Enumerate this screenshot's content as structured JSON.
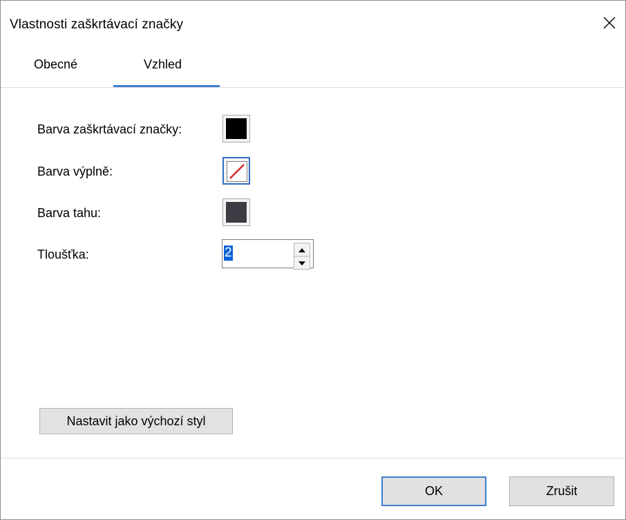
{
  "window": {
    "title": "Vlastnosti zaškrtávací značky"
  },
  "tabs": [
    {
      "label": "Obecné",
      "active": false
    },
    {
      "label": "Vzhled",
      "active": true
    }
  ],
  "appearance": {
    "check_color": {
      "label": "Barva zaškrtávací značky:",
      "color": "#000000"
    },
    "fill_color": {
      "label": "Barva výplně:",
      "value": "none",
      "icon": "no-color-icon"
    },
    "stroke_color": {
      "label": "Barva tahu:",
      "color": "#3c3d44"
    },
    "thickness": {
      "label": "Tloušťka:",
      "value": "2"
    }
  },
  "buttons": {
    "set_default": "Nastavit jako výchozí styl",
    "ok": "OK",
    "cancel": "Zrušit"
  },
  "colors": {
    "accent": "#3d7ed0"
  }
}
